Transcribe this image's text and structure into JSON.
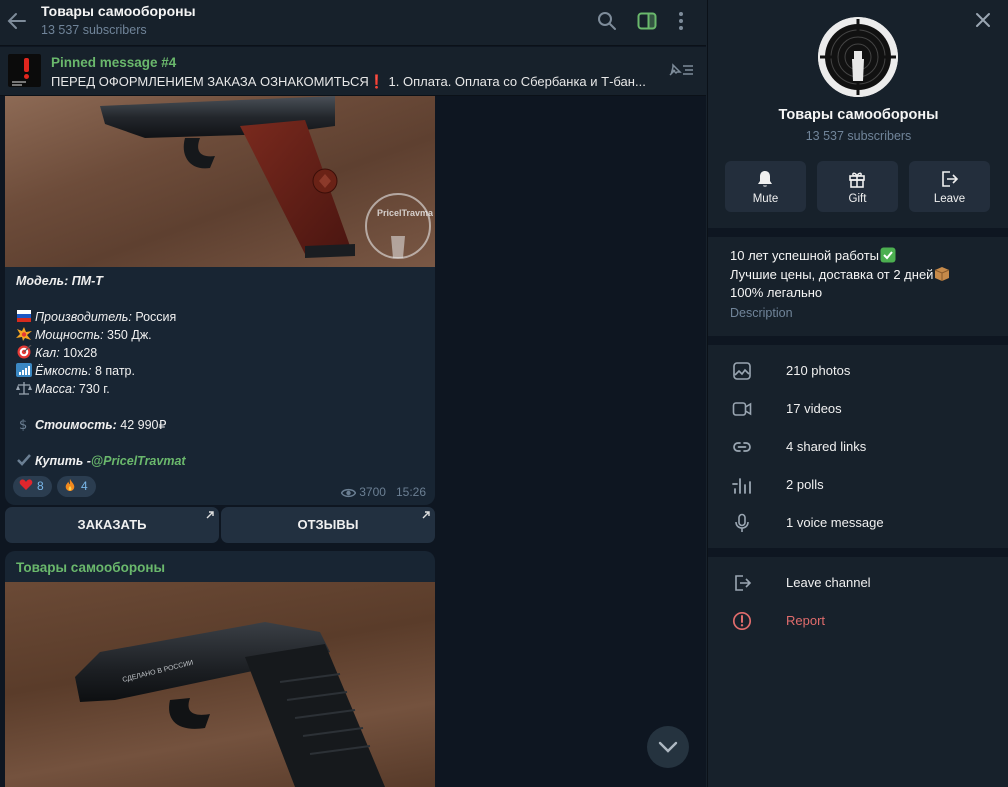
{
  "chat": {
    "title": "Товары самообороны",
    "subscribers": "13 537 subscribers",
    "pinned": {
      "title": "Pinned message #4",
      "text": "ПЕРЕД ОФОРМЛЕНИЕМ ЗАКАЗА ОЗНАКОМИТЬСЯ❗  1. Оплата.  Оплата со Сбербанка и Т-бан..."
    },
    "post1": {
      "watermark": "PricelTravmat",
      "model_label": "Модель: ПМ-Т",
      "lines": [
        {
          "emoji": "flag-russia",
          "label": "Производитель:",
          "value": " Россия"
        },
        {
          "emoji": "collision",
          "label": "Мощность:",
          "value": " 350 Дж."
        },
        {
          "emoji": "target",
          "label": "Кал:",
          "value": " 10x28"
        },
        {
          "emoji": "signal-bars",
          "label": "Ёмкость:",
          "value": " 8 патр."
        },
        {
          "emoji": "balance-scale",
          "label": "Масса:",
          "value": " 730 г."
        }
      ],
      "price_label": "Стоимость:",
      "price_value": " 42 990₽",
      "buy_label": "Купить -",
      "buy_link": "@PricelTravmat",
      "reactions": [
        {
          "emoji": "heart",
          "count": "8"
        },
        {
          "emoji": "fire",
          "count": "4"
        }
      ],
      "views": "3700",
      "time": "15:26",
      "buttons": [
        "ЗАКАЗАТЬ",
        "ОТЗЫВЫ"
      ]
    },
    "post2": {
      "author": "Товары самообороны",
      "gun_engraving": "СДЕЛАНО В РОССИИ"
    },
    "colors": {
      "accent_green": "#6ab86c",
      "link_blue": "#7ab8ea",
      "danger": "#e06c6c"
    }
  },
  "panel": {
    "name": "Товары самообороны",
    "subscribers": "13 537 subscribers",
    "actions": [
      {
        "icon": "bell-icon",
        "label": "Mute"
      },
      {
        "icon": "gift-icon",
        "label": "Gift"
      },
      {
        "icon": "leave-icon",
        "label": "Leave"
      }
    ],
    "description": {
      "line1": "10 лет успешной работы",
      "line2": "Лучшие цены, доставка от 2 дней",
      "line3": "100% легально",
      "label": "Description"
    },
    "media": [
      {
        "icon": "photo-icon",
        "label": "210 photos"
      },
      {
        "icon": "video-icon",
        "label": "17 videos"
      },
      {
        "icon": "link-icon",
        "label": "4 shared links"
      },
      {
        "icon": "poll-icon",
        "label": "2 polls"
      },
      {
        "icon": "mic-icon",
        "label": "1 voice message"
      }
    ],
    "leave": "Leave channel",
    "report": "Report"
  }
}
